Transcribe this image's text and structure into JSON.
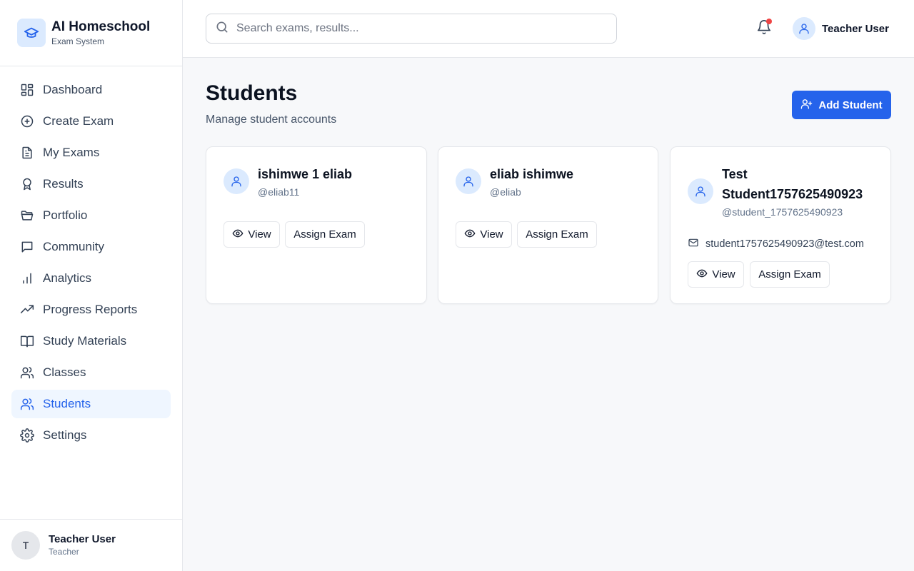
{
  "brand": {
    "title": "AI Homeschool",
    "subtitle": "Exam System"
  },
  "sidebar": {
    "items": [
      {
        "label": "Dashboard",
        "icon": "dashboard-icon"
      },
      {
        "label": "Create Exam",
        "icon": "plus-circle-icon"
      },
      {
        "label": "My Exams",
        "icon": "document-icon"
      },
      {
        "label": "Results",
        "icon": "award-icon"
      },
      {
        "label": "Portfolio",
        "icon": "folder-icon"
      },
      {
        "label": "Community",
        "icon": "chat-icon"
      },
      {
        "label": "Analytics",
        "icon": "bar-chart-icon"
      },
      {
        "label": "Progress Reports",
        "icon": "trending-up-icon"
      },
      {
        "label": "Study Materials",
        "icon": "book-icon"
      },
      {
        "label": "Classes",
        "icon": "users-icon"
      },
      {
        "label": "Students",
        "icon": "users-icon",
        "active": true
      },
      {
        "label": "Settings",
        "icon": "gear-icon"
      }
    ],
    "footer": {
      "initial": "T",
      "name": "Teacher User",
      "role": "Teacher"
    }
  },
  "header": {
    "search_placeholder": "Search exams, results...",
    "user_name": "Teacher User"
  },
  "main": {
    "title": "Students",
    "subtitle": "Manage student accounts",
    "add_button": "Add Student",
    "students": [
      {
        "name": "ishimwe 1 eliab",
        "username": "@eliab11",
        "email": "",
        "view_label": "View",
        "assign_label": "Assign Exam"
      },
      {
        "name": "eliab ishimwe",
        "username": "@eliab",
        "email": "",
        "view_label": "View",
        "assign_label": "Assign Exam"
      },
      {
        "name": "Test Student1757625490923",
        "username": "@student_1757625490923",
        "email": "student1757625490923@test.com",
        "view_label": "View",
        "assign_label": "Assign Exam"
      }
    ]
  },
  "colors": {
    "accent": "#2563eb",
    "active_bg": "#eff6ff",
    "notification_dot": "#ef4444"
  }
}
